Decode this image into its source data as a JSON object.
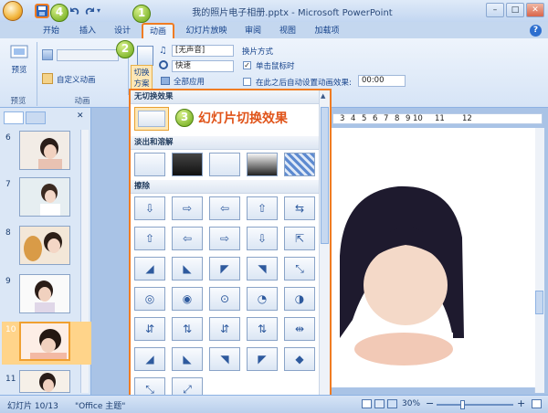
{
  "window": {
    "title": "我的照片电子相册.pptx - Microsoft PowerPoint",
    "controls": [
      "–",
      "□",
      "✕"
    ]
  },
  "tabs": [
    {
      "label": "开始"
    },
    {
      "label": "插入"
    },
    {
      "label": "设计"
    },
    {
      "label": "动画",
      "selected": true
    },
    {
      "label": "幻灯片放映"
    },
    {
      "label": "审阅"
    },
    {
      "label": "视图"
    },
    {
      "label": "加载项"
    }
  ],
  "ribbon": {
    "preview_button": "预览",
    "preview_group": "预览",
    "animate_placeholder": "",
    "custom_anim": "自定义动画",
    "anim_group": "动画",
    "scheme_button": [
      "切换",
      "方案"
    ],
    "sound_value": "[无声音]",
    "speed_value": "快速",
    "apply_all": "全部应用",
    "advance_heading": "换片方式",
    "on_click": "单击鼠标时",
    "auto_after": "在此之后自动设置动画效果:",
    "auto_time": "00:00"
  },
  "gallery": {
    "section_none": "无切换效果",
    "section_fade": "淡出和溶解",
    "section_wipe": "擦除",
    "callout": "幻灯片切换效果"
  },
  "ruler": [
    "3",
    "4",
    "5",
    "6",
    "7",
    "8",
    "9",
    "10",
    "11",
    "12"
  ],
  "slides": [
    {
      "num": "6"
    },
    {
      "num": "7"
    },
    {
      "num": "8"
    },
    {
      "num": "9"
    },
    {
      "num": "10"
    },
    {
      "num": "11"
    }
  ],
  "statusbar": {
    "slide_info": "幻灯片 10/13",
    "theme": "\"Office 主题\"",
    "zoom": "30%",
    "zoom_minus": "−",
    "zoom_plus": "+"
  },
  "badges": [
    "1",
    "2",
    "3",
    "4"
  ],
  "colors": {
    "accent": "#f07c22",
    "badge": "#68a614",
    "ribbon": "#dde8f6"
  }
}
